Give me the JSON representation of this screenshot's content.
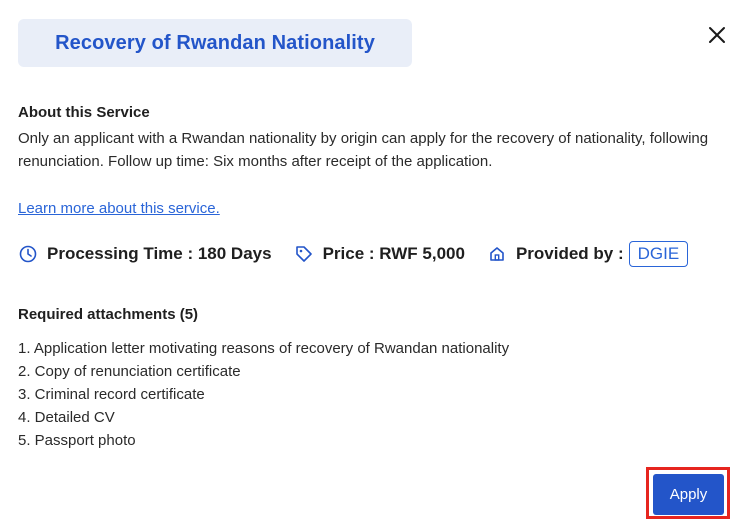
{
  "modal": {
    "title": "Recovery of Rwandan Nationality",
    "close_icon": "close-icon"
  },
  "about": {
    "heading": "About this Service",
    "text": "Only an applicant with a Rwandan nationality by origin can apply for the recovery of nationality, following renunciation. Follow up time: Six months after receipt of the application.",
    "learn_more": "Learn more about this service."
  },
  "meta": {
    "processing_time": "Processing Time : 180 Days",
    "processing_icon": "clock-icon",
    "price": "Price : RWF 5,000",
    "price_icon": "tag-icon",
    "provided_by_label": "Provided by :",
    "provided_by_icon": "home-icon",
    "provider": "DGIE"
  },
  "attachments": {
    "heading": "Required attachments (5)",
    "items": [
      "1. Application letter motivating reasons of recovery of Rwandan nationality",
      "2. Copy of renunciation certificate",
      "3. Criminal record certificate",
      "4. Detailed CV",
      "5. Passport photo"
    ]
  },
  "actions": {
    "apply_label": "Apply"
  },
  "colors": {
    "accent": "#2355c9",
    "link": "#2a65d8",
    "title_bg": "#e9eef8",
    "highlight": "#e6251f"
  }
}
